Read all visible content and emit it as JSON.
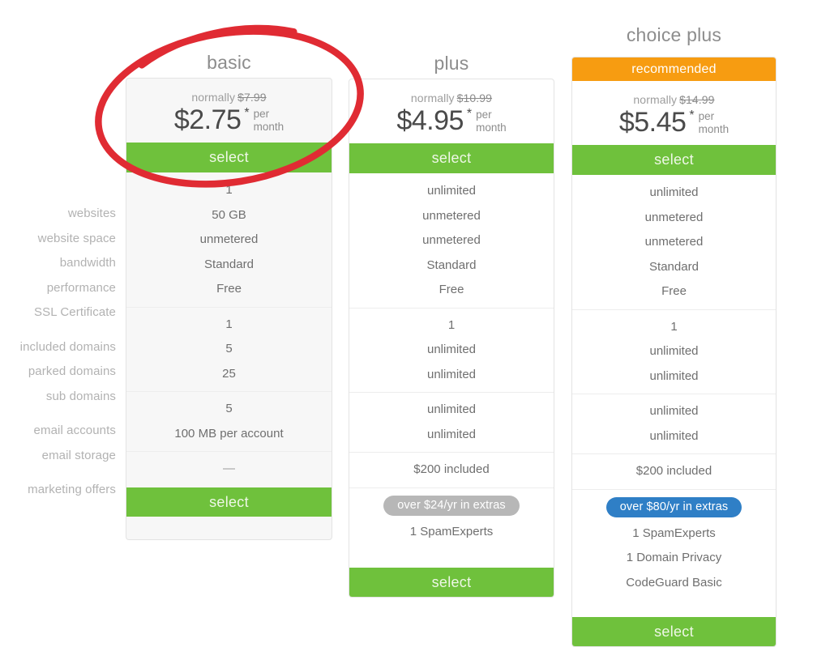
{
  "colors": {
    "green": "#6fc13c",
    "orange": "#f79c11",
    "blue": "#2f7fc6",
    "gray_pill": "#b7b7b7",
    "annotation_red": "#e02b33",
    "label_gray": "#b2b2b2",
    "value_gray": "#6f6f6f"
  },
  "feature_labels": {
    "group1": [
      "websites",
      "website space",
      "bandwidth",
      "performance",
      "SSL Certificate"
    ],
    "group2": [
      "included domains",
      "parked domains",
      "sub domains"
    ],
    "group3": [
      "email accounts",
      "email storage"
    ],
    "group4": [
      "marketing offers"
    ]
  },
  "plans": [
    {
      "id": "basic",
      "title": "basic",
      "recommended_label": "",
      "normally_prefix": "normally",
      "normally_price": "$7.99",
      "price": "$2.75",
      "star": "*",
      "per": "per",
      "month": "month",
      "select_label": "select",
      "select_label_bottom": "select",
      "group1": [
        "1",
        "50 GB",
        "unmetered",
        "Standard",
        "Free"
      ],
      "group2": [
        "1",
        "5",
        "25"
      ],
      "group3": [
        "5",
        "100 MB per account"
      ],
      "group4": [
        "—"
      ],
      "extras_pill": "",
      "extras": []
    },
    {
      "id": "plus",
      "title": "plus",
      "recommended_label": "",
      "normally_prefix": "normally",
      "normally_price": "$10.99",
      "price": "$4.95",
      "star": "*",
      "per": "per",
      "month": "month",
      "select_label": "select",
      "select_label_bottom": "select",
      "group1": [
        "unlimited",
        "unmetered",
        "unmetered",
        "Standard",
        "Free"
      ],
      "group2": [
        "1",
        "unlimited",
        "unlimited"
      ],
      "group3": [
        "unlimited",
        "unlimited"
      ],
      "group4": [
        "$200 included"
      ],
      "extras_pill": "over $24/yr in extras",
      "extras": [
        "1 SpamExperts"
      ]
    },
    {
      "id": "choice-plus",
      "title": "choice plus",
      "recommended_label": "recommended",
      "normally_prefix": "normally",
      "normally_price": "$14.99",
      "price": "$5.45",
      "star": "*",
      "per": "per",
      "month": "month",
      "select_label": "select",
      "select_label_bottom": "select",
      "group1": [
        "unlimited",
        "unmetered",
        "unmetered",
        "Standard",
        "Free"
      ],
      "group2": [
        "1",
        "unlimited",
        "unlimited"
      ],
      "group3": [
        "unlimited",
        "unlimited"
      ],
      "group4": [
        "$200 included"
      ],
      "extras_pill": "over $80/yr in extras",
      "extras": [
        "1 SpamExperts",
        "1 Domain Privacy",
        "CodeGuard Basic"
      ]
    }
  ],
  "annotation": {
    "type": "hand-drawn-ellipse",
    "color": "#e02b33",
    "target": "basic"
  }
}
